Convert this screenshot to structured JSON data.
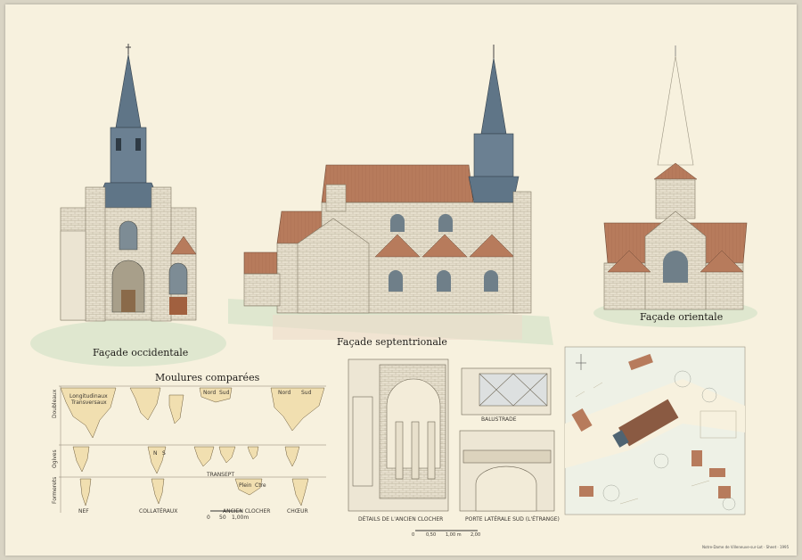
{
  "sheet": {
    "facade_west": "Façade occidentale",
    "facade_north": "Façade septentrionale",
    "facade_east": "Façade orientale",
    "moulures_title": "Moulures comparées",
    "row_labels": [
      "Doubleaux",
      "Ogives",
      "Formerets"
    ],
    "profile_labels": {
      "longitudinaux": "Longitudinaux",
      "transversaux": "Transversaux",
      "nord1": "Nord",
      "sud1": "Sud",
      "nord2": "Nord",
      "sud2": "Sud",
      "n": "N",
      "s": "S",
      "plein": "Plein",
      "ctre": "Ctre"
    },
    "column_labels": [
      "NEF",
      "COLLATÉRAUX",
      "TRANSEPT",
      "ANCIEN CLOCHER",
      "CHŒUR"
    ],
    "scale_moulures": [
      "0",
      "50",
      "1,00m"
    ],
    "detail_balustrade": "BALUSTRADE",
    "detail_clocher": "DÉTAILS DE L'ANCIEN CLOCHER",
    "detail_porte": "PORTE LATÉRALE SUD (L'ÉTRANGE)",
    "scale_details": [
      "0",
      "0,50",
      "1,00 m",
      "2,00"
    ],
    "footer_note": "Notre-Dame de Villeneuve-sur-Lot · Sheet · 1995"
  },
  "colors": {
    "paper": "#f7f1de",
    "stone": "#e4ddcb",
    "roof_tile": "#b67a5a",
    "slate": "#5f7587",
    "grass": "#dfe7cf",
    "moulure": "#f1dfb0"
  }
}
